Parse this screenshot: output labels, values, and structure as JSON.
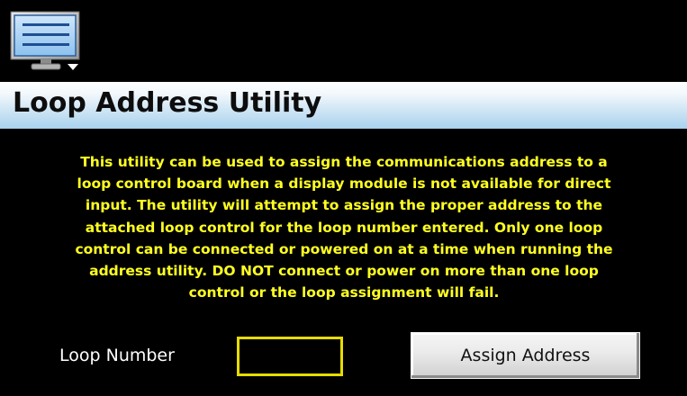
{
  "header": {
    "menu_icon": "monitor-menu-icon"
  },
  "title": "Loop Address Utility",
  "description": "This utility can be used to assign the communications address to a\nloop control board when a display module is not available for direct\ninput.  The utility will attempt to assign the proper address to the\nattached loop control for the loop number entered.  Only one loop\ncontrol can be connected or powered on at a time when running the\naddress utility.  DO NOT connect or power on more than one loop\ncontrol or the loop assignment will fail.",
  "form": {
    "loop_number_label": "Loop Number",
    "loop_number_value": "",
    "assign_button_label": "Assign Address"
  },
  "colors": {
    "background": "#000000",
    "description_text": "#ffff22",
    "input_border": "#e6dc00",
    "title_gradient_top": "#ffffff",
    "title_gradient_bottom": "#a9d2ee"
  }
}
